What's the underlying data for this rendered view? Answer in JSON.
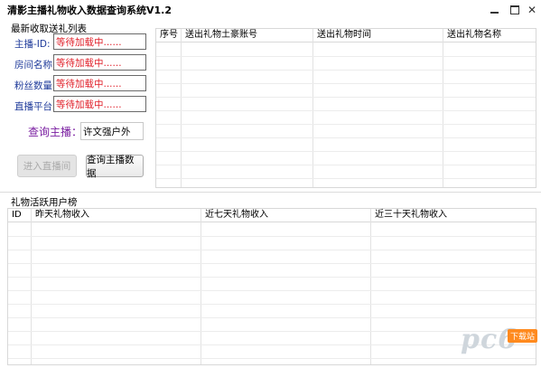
{
  "window": {
    "title": "清影主播礼物收入数据查询系统V1.2",
    "minimize_label": "—",
    "close_label": "✕"
  },
  "left_panel": {
    "group_title": "最新收取送礼列表",
    "fields": [
      {
        "label": "主播-ID:",
        "value": "等待加载中......"
      },
      {
        "label": "房间名称:",
        "value": "等待加载中......"
      },
      {
        "label": "粉丝数量:",
        "value": "等待加载中......"
      },
      {
        "label": "直播平台:",
        "value": "等待加载中......"
      }
    ],
    "query_label": "查询主播：",
    "query_value": "许文强户外",
    "enter_room_button": "进入直播间",
    "query_button": "查询主播数据"
  },
  "gift_table": {
    "columns": [
      "序号",
      "送出礼物土豪账号",
      "送出礼物时间",
      "送出礼物名称"
    ],
    "rows": []
  },
  "ranking": {
    "group_title": "礼物活跃用户榜",
    "columns": [
      "ID",
      "昨天礼物收入",
      "近七天礼物收入",
      "近三十天礼物收入"
    ],
    "rows": []
  },
  "watermark": {
    "text": "pc6",
    "badge": "下载站"
  },
  "colors": {
    "field_label": "#1e3a9a",
    "field_value": "#e0202a",
    "query_label": "#7a1ea1"
  }
}
